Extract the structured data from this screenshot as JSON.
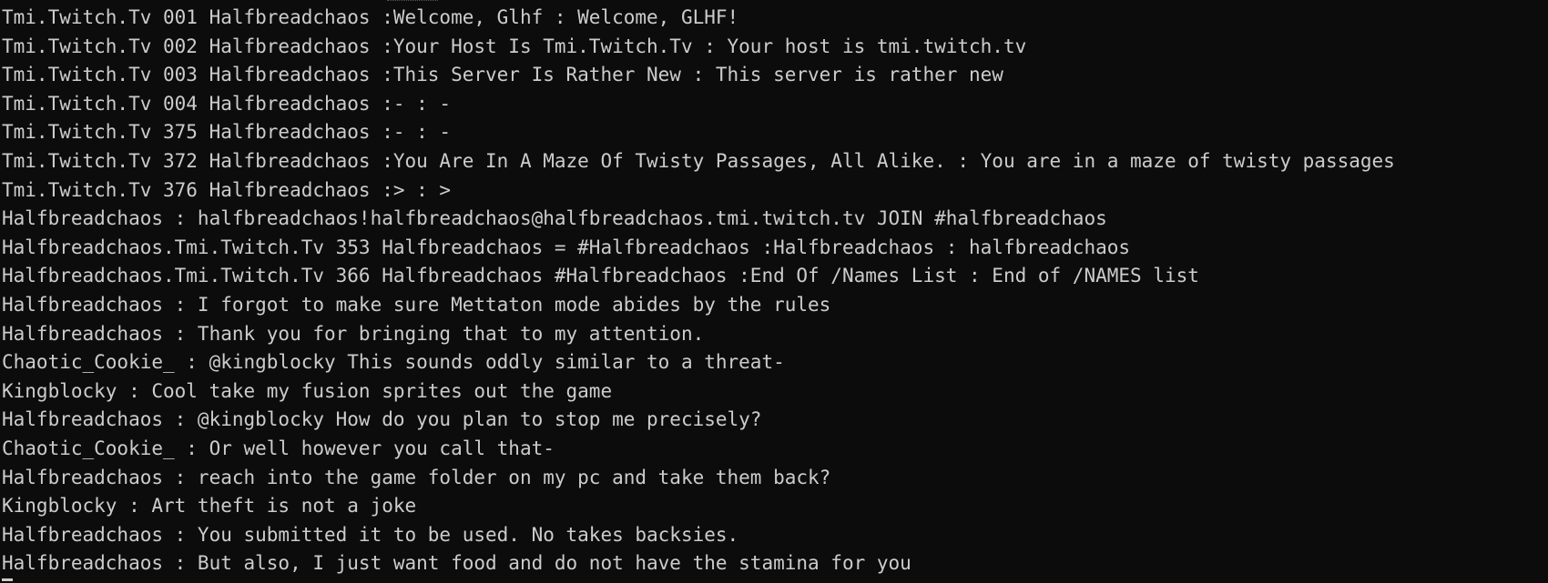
{
  "console": {
    "lines": [
      "Tmi.Twitch.Tv 001 Halfbreadchaos :Welcome, Glhf : Welcome, GLHF!",
      "Tmi.Twitch.Tv 002 Halfbreadchaos :Your Host Is Tmi.Twitch.Tv : Your host is tmi.twitch.tv",
      "Tmi.Twitch.Tv 003 Halfbreadchaos :This Server Is Rather New : This server is rather new",
      "Tmi.Twitch.Tv 004 Halfbreadchaos :- : -",
      "Tmi.Twitch.Tv 375 Halfbreadchaos :- : -",
      "Tmi.Twitch.Tv 372 Halfbreadchaos :You Are In A Maze Of Twisty Passages, All Alike. : You are in a maze of twisty passages",
      "Tmi.Twitch.Tv 376 Halfbreadchaos :> : >",
      "Halfbreadchaos : halfbreadchaos!halfbreadchaos@halfbreadchaos.tmi.twitch.tv JOIN #halfbreadchaos",
      "Halfbreadchaos.Tmi.Twitch.Tv 353 Halfbreadchaos = #Halfbreadchaos :Halfbreadchaos : halfbreadchaos",
      "Halfbreadchaos.Tmi.Twitch.Tv 366 Halfbreadchaos #Halfbreadchaos :End Of /Names List : End of /NAMES list",
      "Halfbreadchaos : I forgot to make sure Mettaton mode abides by the rules",
      "Halfbreadchaos : Thank you for bringing that to my attention.",
      "Chaotic_Cookie_ : @kingblocky This sounds oddly similar to a threat-",
      "Kingblocky : Cool take my fusion sprites out the game",
      "Halfbreadchaos : @kingblocky How do you plan to stop me precisely?",
      "Chaotic_Cookie_ : Or well however you call that-",
      "Halfbreadchaos : reach into the game folder on my pc and take them back?",
      "Kingblocky : Art theft is not a joke",
      "Halfbreadchaos : You submitted it to be used. No takes backsies.",
      "Halfbreadchaos : But also, I just want food and do not have the stamina for you"
    ]
  },
  "colors": {
    "background": "#0c0c0c",
    "text": "#cccccc"
  }
}
